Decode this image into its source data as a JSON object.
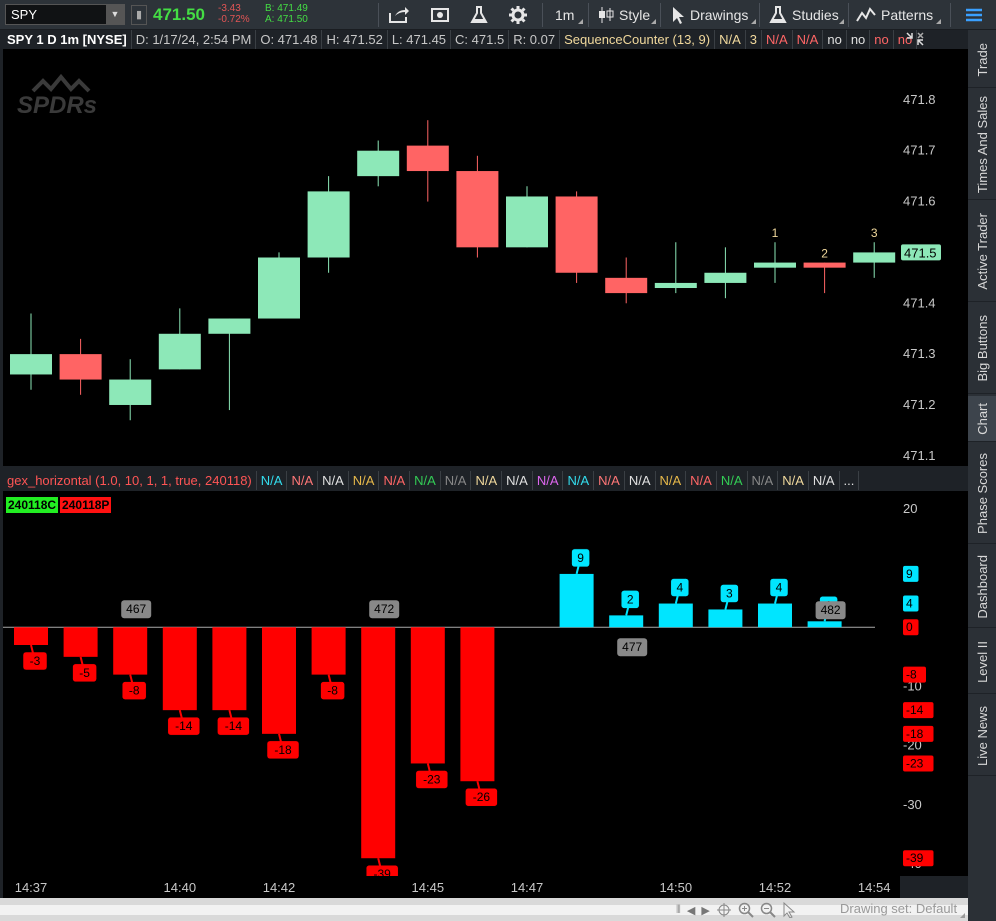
{
  "toolbar": {
    "symbol": "SPY",
    "last": "471.50",
    "change": "-3.43",
    "change_pct": "-0.72%",
    "bid": "B: 471.49",
    "ask": "A: 471.50",
    "timeframe": "1m",
    "style": "Style",
    "drawings": "Drawings",
    "studies": "Studies",
    "patterns": "Patterns"
  },
  "header": {
    "title": "SPY 1 D 1m [NYSE]",
    "date": "D: 1/17/24, 2:54 PM",
    "open": "O: 471.48",
    "high": "H: 471.52",
    "low": "L: 471.45",
    "close": "C: 471.5",
    "range": "R: 0.07",
    "study": "SequenceCounter (13, 9)",
    "values": [
      {
        "text": "N/A",
        "color": "#f0d89c"
      },
      {
        "text": "3",
        "color": "#f0d89c"
      },
      {
        "text": "N/A",
        "color": "#ff6666"
      },
      {
        "text": "N/A",
        "color": "#ff6666"
      },
      {
        "text": "no",
        "color": "#e0e0e0"
      },
      {
        "text": "no",
        "color": "#e0e0e0"
      },
      {
        "text": "no",
        "color": "#ff6666"
      },
      {
        "text": "no",
        "color": "#ff6666"
      }
    ]
  },
  "logo_text": "SPDRs",
  "lower_header": {
    "study": "gex_horizontal (1.0, 10, 1, 1, true, 240118)",
    "values": [
      {
        "text": "N/A",
        "color": "#33ddee"
      },
      {
        "text": "N/A",
        "color": "#ff7777"
      },
      {
        "text": "N/A",
        "color": "#e0e0e0"
      },
      {
        "text": "N/A",
        "color": "#e6b84a"
      },
      {
        "text": "N/A",
        "color": "#ff6666"
      },
      {
        "text": "N/A",
        "color": "#33cc55"
      },
      {
        "text": "N/A",
        "color": "#888888"
      },
      {
        "text": "N/A",
        "color": "#f0d89c"
      },
      {
        "text": "N/A",
        "color": "#e0e0e0"
      },
      {
        "text": "N/A",
        "color": "#dd66ee"
      },
      {
        "text": "N/A",
        "color": "#33ddee"
      },
      {
        "text": "N/A",
        "color": "#ff7777"
      },
      {
        "text": "N/A",
        "color": "#e0e0e0"
      },
      {
        "text": "N/A",
        "color": "#e6b84a"
      },
      {
        "text": "N/A",
        "color": "#ff6666"
      },
      {
        "text": "N/A",
        "color": "#33cc55"
      },
      {
        "text": "N/A",
        "color": "#888888"
      },
      {
        "text": "N/A",
        "color": "#f0d89c"
      },
      {
        "text": "N/A",
        "color": "#e0e0e0"
      },
      {
        "text": "...",
        "color": "#e0e0e0"
      }
    ],
    "legend_calls": "240118C",
    "legend_puts": "240118P"
  },
  "chart_data": [
    {
      "type": "candlestick",
      "ylim": [
        471.08,
        471.9
      ],
      "yticks": [
        "471.8",
        "471.7",
        "471.6",
        "471.5",
        "471.4",
        "471.3",
        "471.2",
        "471.1"
      ],
      "last_label": "471.5",
      "candles": [
        {
          "o": 471.26,
          "h": 471.38,
          "l": 471.23,
          "c": 471.3,
          "up": true,
          "label": ""
        },
        {
          "o": 471.3,
          "h": 471.33,
          "l": 471.22,
          "c": 471.25,
          "up": false,
          "label": ""
        },
        {
          "o": 471.2,
          "h": 471.29,
          "l": 471.17,
          "c": 471.25,
          "up": true,
          "label": ""
        },
        {
          "o": 471.27,
          "h": 471.39,
          "l": 471.27,
          "c": 471.34,
          "up": true,
          "label": ""
        },
        {
          "o": 471.34,
          "h": 471.37,
          "l": 471.19,
          "c": 471.37,
          "up": true,
          "label": ""
        },
        {
          "o": 471.37,
          "h": 471.5,
          "l": 471.37,
          "c": 471.49,
          "up": true,
          "label": ""
        },
        {
          "o": 471.49,
          "h": 471.65,
          "l": 471.46,
          "c": 471.62,
          "up": true,
          "label": ""
        },
        {
          "o": 471.65,
          "h": 471.72,
          "l": 471.63,
          "c": 471.7,
          "up": true,
          "label": ""
        },
        {
          "o": 471.71,
          "h": 471.76,
          "l": 471.6,
          "c": 471.66,
          "up": false,
          "label": ""
        },
        {
          "o": 471.66,
          "h": 471.69,
          "l": 471.49,
          "c": 471.51,
          "up": false,
          "label": ""
        },
        {
          "o": 471.51,
          "h": 471.63,
          "l": 471.51,
          "c": 471.61,
          "up": true,
          "label": ""
        },
        {
          "o": 471.61,
          "h": 471.62,
          "l": 471.44,
          "c": 471.46,
          "up": false,
          "label": ""
        },
        {
          "o": 471.45,
          "h": 471.49,
          "l": 471.4,
          "c": 471.42,
          "up": false,
          "label": ""
        },
        {
          "o": 471.43,
          "h": 471.52,
          "l": 471.42,
          "c": 471.44,
          "up": true,
          "label": ""
        },
        {
          "o": 471.44,
          "h": 471.51,
          "l": 471.41,
          "c": 471.46,
          "up": true,
          "label": ""
        },
        {
          "o": 471.47,
          "h": 471.52,
          "l": 471.44,
          "c": 471.48,
          "up": true,
          "label": "1"
        },
        {
          "o": 471.48,
          "h": 471.48,
          "l": 471.42,
          "c": 471.47,
          "up": false,
          "label": "2"
        },
        {
          "o": 471.48,
          "h": 471.52,
          "l": 471.45,
          "c": 471.5,
          "up": true,
          "label": "3"
        }
      ]
    },
    {
      "type": "bar",
      "ylim": [
        -42,
        23
      ],
      "yticks": [
        "20",
        "-10",
        "-20",
        "-30",
        "-40"
      ],
      "x": [
        "14:37",
        "14:38",
        "14:39",
        "14:40",
        "14:41",
        "14:42",
        "14:43",
        "14:44",
        "14:45",
        "14:46",
        "14:47",
        "14:48",
        "14:49",
        "14:50",
        "14:51",
        "14:52",
        "14:53",
        "14:54"
      ],
      "values": [
        -3,
        -5,
        -8,
        -14,
        -14,
        -18,
        -8,
        -39,
        -23,
        -26,
        null,
        9,
        2,
        4,
        3,
        4,
        1,
        null
      ],
      "strike_labels": [
        {
          "index": 2,
          "text": "467",
          "pos": "above"
        },
        {
          "index": 7,
          "text": "472",
          "pos": "above"
        },
        {
          "index": 12,
          "text": "477",
          "pos": "below"
        },
        {
          "index": 16,
          "text": "482",
          "pos": "over"
        }
      ],
      "axis_badges": [
        {
          "value": 9,
          "text": "9",
          "color": "#00e5ff"
        },
        {
          "value": 4,
          "text": "4",
          "color": "#00e5ff"
        },
        {
          "value": 0,
          "text": "0",
          "color": "#ff0000"
        },
        {
          "value": -8,
          "text": "-8",
          "color": "#ff0000"
        },
        {
          "value": -14,
          "text": "-14",
          "color": "#ff0000"
        },
        {
          "value": -18,
          "text": "-18",
          "color": "#ff0000"
        },
        {
          "value": -23,
          "text": "-23",
          "color": "#ff0000"
        },
        {
          "value": -39,
          "text": "-39",
          "color": "#ff0000"
        }
      ]
    }
  ],
  "xaxis_ticks": [
    {
      "index": 0,
      "text": "14:37"
    },
    {
      "index": 3,
      "text": "14:40"
    },
    {
      "index": 5,
      "text": "14:42"
    },
    {
      "index": 8,
      "text": "14:45"
    },
    {
      "index": 10,
      "text": "14:47"
    },
    {
      "index": 13,
      "text": "14:50"
    },
    {
      "index": 15,
      "text": "14:52"
    },
    {
      "index": 17,
      "text": "14:54"
    }
  ],
  "status": {
    "drawing_set": "Drawing set: Default"
  },
  "sidebar": [
    "Trade",
    "Times And Sales",
    "Active Trader",
    "Big Buttons",
    "Chart",
    "Phase Scores",
    "Dashboard",
    "Level II",
    "Live News"
  ],
  "colors": {
    "up": "#8de8b8",
    "down": "#ff6464",
    "calls": "#00e5ff",
    "puts": "#ff0000",
    "strike": "#888888"
  }
}
